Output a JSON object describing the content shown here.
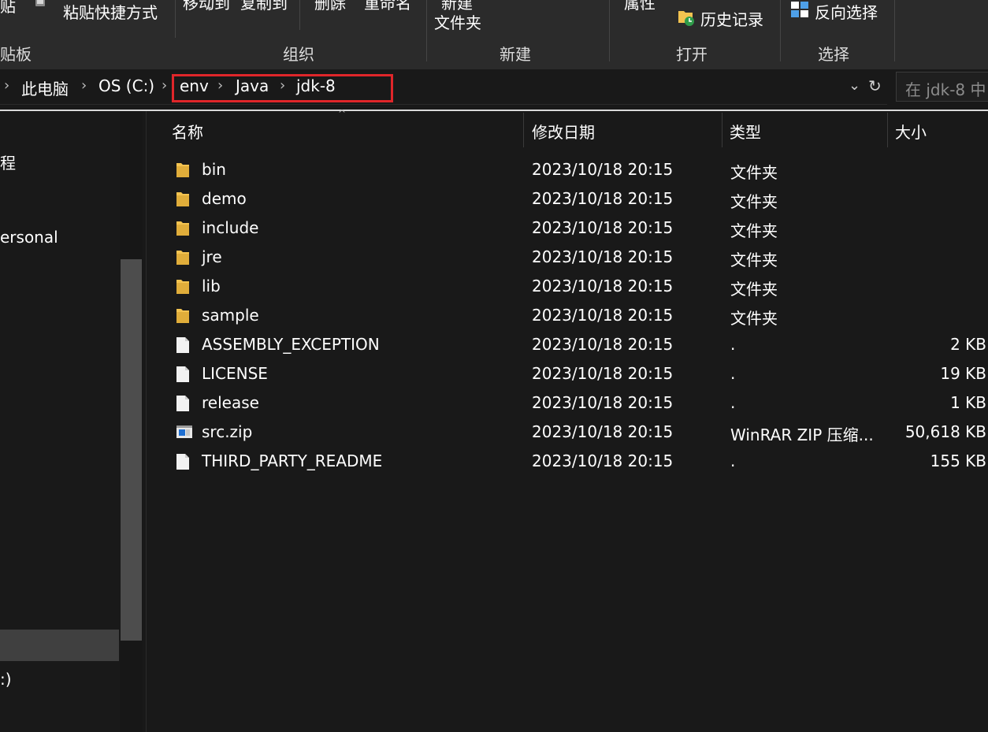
{
  "ribbon": {
    "clipboard": {
      "paste_partial": "贴",
      "paste_shortcut_label": "粘贴快捷方式",
      "group_label": "贴板"
    },
    "organize": {
      "move_to": "移动到",
      "copy_to": "复制到",
      "delete": "删除",
      "rename": "重命名",
      "group_label": "组织"
    },
    "new": {
      "new_folder_line1": "新建",
      "new_folder_line2": "文件夹",
      "group_label": "新建"
    },
    "open": {
      "properties": "属性",
      "history": "历史记录",
      "group_label": "打开"
    },
    "select": {
      "invert_selection": "反向选择",
      "group_label": "选择"
    }
  },
  "address": {
    "crumbs": [
      "此电脑",
      "OS (C:)",
      "env",
      "Java",
      "jdk-8"
    ],
    "search_placeholder": "在 jdk-8 中"
  },
  "nav": {
    "items": [
      "程",
      "ersonal",
      ":)"
    ]
  },
  "list": {
    "columns": {
      "name": "名称",
      "modified": "修改日期",
      "type": "类型",
      "size": "大小"
    },
    "rows": [
      {
        "name": "bin",
        "modified": "2023/10/18 20:15",
        "type": "文件夹",
        "size": "",
        "icon": "folder-icon"
      },
      {
        "name": "demo",
        "modified": "2023/10/18 20:15",
        "type": "文件夹",
        "size": "",
        "icon": "folder-icon"
      },
      {
        "name": "include",
        "modified": "2023/10/18 20:15",
        "type": "文件夹",
        "size": "",
        "icon": "folder-icon"
      },
      {
        "name": "jre",
        "modified": "2023/10/18 20:15",
        "type": "文件夹",
        "size": "",
        "icon": "folder-icon"
      },
      {
        "name": "lib",
        "modified": "2023/10/18 20:15",
        "type": "文件夹",
        "size": "",
        "icon": "folder-icon"
      },
      {
        "name": "sample",
        "modified": "2023/10/18 20:15",
        "type": "文件夹",
        "size": "",
        "icon": "folder-icon"
      },
      {
        "name": "ASSEMBLY_EXCEPTION",
        "modified": "2023/10/18 20:15",
        "type": ".",
        "size": "2 KB",
        "icon": "file-icon"
      },
      {
        "name": "LICENSE",
        "modified": "2023/10/18 20:15",
        "type": ".",
        "size": "19 KB",
        "icon": "file-icon"
      },
      {
        "name": "release",
        "modified": "2023/10/18 20:15",
        "type": ".",
        "size": "1 KB",
        "icon": "file-icon"
      },
      {
        "name": "src.zip",
        "modified": "2023/10/18 20:15",
        "type": "WinRAR ZIP 压缩...",
        "size": "50,618 KB",
        "icon": "zip-file-icon"
      },
      {
        "name": "THIRD_PARTY_README",
        "modified": "2023/10/18 20:15",
        "type": ".",
        "size": "155 KB",
        "icon": "file-icon"
      }
    ]
  },
  "colors": {
    "highlight_box": "#e0262a",
    "folder": "#f3c350",
    "background": "#191919",
    "ribbon": "#2b2b2b"
  }
}
